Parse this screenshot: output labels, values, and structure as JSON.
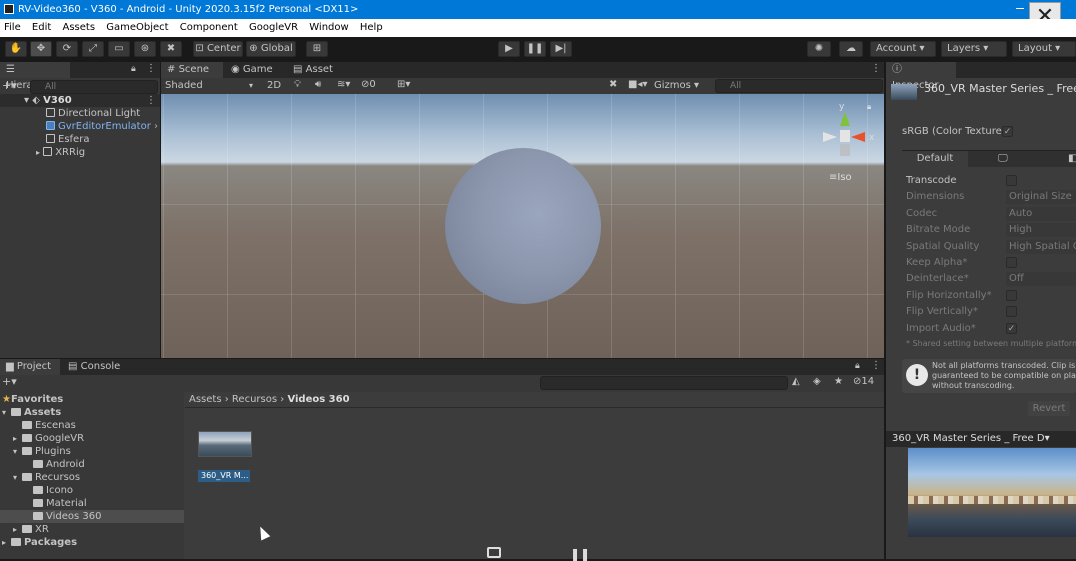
{
  "window": {
    "title": "RV-Video360 - V360 - Android - Unity 2020.3.15f2 Personal <DX11>",
    "close_glyph": "✕"
  },
  "menu": [
    "File",
    "Edit",
    "Assets",
    "GameObject",
    "Component",
    "GoogleVR",
    "Window",
    "Help"
  ],
  "toolbar": {
    "pivot": "Center",
    "space": "Global",
    "account": "Account ▾",
    "layers": "Layers ▾",
    "layout": "Layout ▾"
  },
  "hierarchy": {
    "tab": "Hierarchy",
    "search_placeholder": "All",
    "scene": "V360",
    "items": [
      "Directional Light",
      "GvrEditorEmulator",
      "Esfera",
      "XRRig"
    ]
  },
  "scene": {
    "tabs": [
      "Scene",
      "Game",
      "Asset Store"
    ],
    "shading": "Shaded",
    "mode2d": "2D",
    "hidden_count": "0",
    "gizmos": "Gizmos",
    "search_placeholder": "All",
    "iso": "Iso",
    "axis_x": "x",
    "axis_y": "y"
  },
  "project": {
    "tabs": [
      "Project",
      "Console"
    ],
    "hidden_count": "14",
    "breadcrumb": [
      "Assets",
      "Recursos",
      "Videos 360"
    ],
    "tree": [
      {
        "label": "Favorites",
        "indent": 0
      },
      {
        "label": "Assets",
        "indent": 0
      },
      {
        "label": "Escenas",
        "indent": 1
      },
      {
        "label": "GoogleVR",
        "indent": 1
      },
      {
        "label": "Plugins",
        "indent": 1
      },
      {
        "label": "Android",
        "indent": 2
      },
      {
        "label": "Recursos",
        "indent": 1
      },
      {
        "label": "Icono",
        "indent": 2
      },
      {
        "label": "Material",
        "indent": 2
      },
      {
        "label": "Videos 360",
        "indent": 2
      },
      {
        "label": "XR",
        "indent": 1
      },
      {
        "label": "Packages",
        "indent": 0
      }
    ],
    "asset_label": "360_VR M..."
  },
  "inspector": {
    "tab": "Inspector",
    "asset_title": "360_VR Master Series _ Free",
    "srgb": "sRGB (Color Texture)",
    "platform_tab": "Default",
    "rows": [
      {
        "label": "Transcode",
        "value": ""
      },
      {
        "label": "Dimensions",
        "value": "Original Size"
      },
      {
        "label": "Codec",
        "value": "Auto"
      },
      {
        "label": "Bitrate Mode",
        "value": "High"
      },
      {
        "label": "Spatial Quality",
        "value": "High Spatial Q"
      },
      {
        "label": "Keep Alpha*",
        "value": ""
      },
      {
        "label": "Deinterlace*",
        "value": "Off"
      },
      {
        "label": "Flip Horizontally*",
        "value": ""
      },
      {
        "label": "Flip Vertically*",
        "value": ""
      },
      {
        "label": "Import Audio*",
        "value": "✓"
      }
    ],
    "note": "* Shared setting between multiple platform",
    "warning": [
      "Not all platforms transcoded. Clip is",
      "guaranteed to be compatible on plat",
      "without transcoding."
    ],
    "revert": "Revert",
    "preview_title": "360_VR Master Series _ Free D▾"
  }
}
